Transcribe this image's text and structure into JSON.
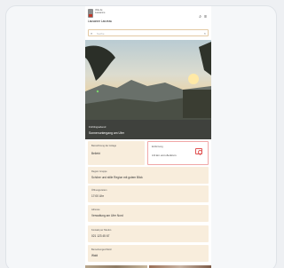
{
  "header": {
    "logo_text_1": "Ville de",
    "logo_text_2": "Lausanne",
    "title": "Lausanne Lanzeau",
    "menu_icon": "hamburger-icon",
    "search_icon": "search-icon"
  },
  "search": {
    "placeholder": "Suche"
  },
  "hero": {
    "kicker": "Frühlingsabend",
    "title": "Sonnenuntergang am Ufer"
  },
  "cards": {
    "type_label": "Bezeichnung der Anlage",
    "type_value": "Beliebt",
    "distance_label": "Entfernung",
    "distance_value": "4.3 km vom Zentrum",
    "region_label": "Region Gruppe",
    "region_value": "Schöne und stille Region mit gutem Blick",
    "hours_label": "Öffnungszeiten",
    "hours_value": "17:00 Uhr",
    "address_label": "Adresse",
    "address_value": "Verwaltung am Ufer Nord",
    "contact_label": "Kontakt per Telefon",
    "contact_value": "021 123 45 67",
    "remarks_label": "Bemerkungen/Notiz",
    "remarks_value": "Wald"
  }
}
